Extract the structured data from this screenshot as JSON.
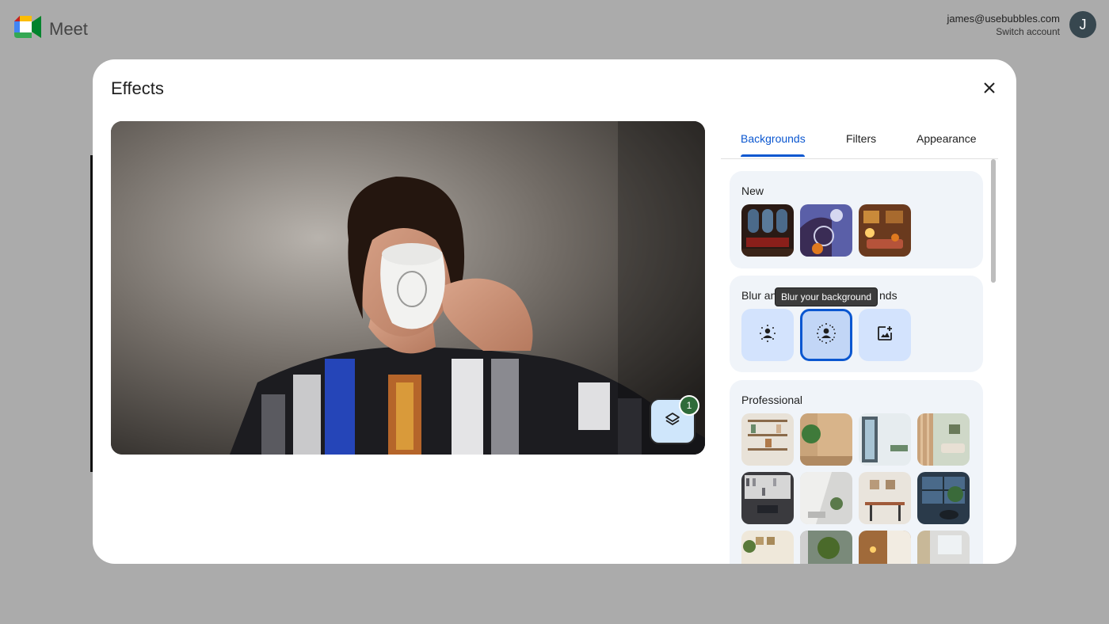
{
  "app": {
    "name": "Meet"
  },
  "account": {
    "email": "james@usebubbles.com",
    "switch_label": "Switch account",
    "avatar_initial": "J"
  },
  "dialog": {
    "title": "Effects"
  },
  "preview": {
    "layers_badge_count": "1"
  },
  "tabs": [
    {
      "label": "Backgrounds",
      "active": true
    },
    {
      "label": "Filters",
      "active": false
    },
    {
      "label": "Appearance",
      "active": false
    }
  ],
  "sections": {
    "new": {
      "title": "New"
    },
    "blur": {
      "title_left": "Blur an",
      "title_right": "nds",
      "tooltip": "Blur your background"
    },
    "professional": {
      "title": "Professional"
    }
  },
  "icons": [
    "meet-logo-icon",
    "close-icon",
    "layers-icon",
    "slight-blur-icon",
    "blur-icon",
    "upload-background-icon"
  ],
  "colors": {
    "accent": "#0b57d0",
    "panel_bg": "#f0f4f9",
    "badge": "#2f6b3a",
    "overlay": "#ababab"
  }
}
